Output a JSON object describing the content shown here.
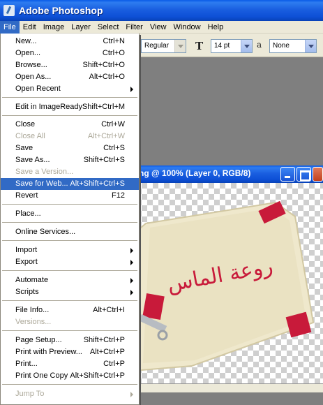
{
  "window": {
    "title": "Adobe Photoshop"
  },
  "menubar": [
    "File",
    "Edit",
    "Image",
    "Layer",
    "Select",
    "Filter",
    "View",
    "Window",
    "Help"
  ],
  "options": {
    "font_style": "Regular",
    "font_size": "14 pt",
    "antialias": "None"
  },
  "document": {
    "title": "ng @ 100% (Layer 0, RGB/8)",
    "artwork_text": "روعة الماس"
  },
  "file_menu": {
    "items": [
      {
        "label": "New...",
        "shortcut": "Ctrl+N"
      },
      {
        "label": "Open...",
        "shortcut": "Ctrl+O"
      },
      {
        "label": "Browse...",
        "shortcut": "Shift+Ctrl+O"
      },
      {
        "label": "Open As...",
        "shortcut": "Alt+Ctrl+O"
      },
      {
        "label": "Open Recent",
        "shortcut": ""
      },
      {
        "label": "Edit in ImageReady",
        "shortcut": "Shift+Ctrl+M"
      },
      {
        "label": "Close",
        "shortcut": "Ctrl+W"
      },
      {
        "label": "Close All",
        "shortcut": "Alt+Ctrl+W"
      },
      {
        "label": "Save",
        "shortcut": "Ctrl+S"
      },
      {
        "label": "Save As...",
        "shortcut": "Shift+Ctrl+S"
      },
      {
        "label": "Save a Version...",
        "shortcut": ""
      },
      {
        "label": "Save for Web...",
        "shortcut": "Alt+Shift+Ctrl+S"
      },
      {
        "label": "Revert",
        "shortcut": "F12"
      },
      {
        "label": "Place...",
        "shortcut": ""
      },
      {
        "label": "Online Services...",
        "shortcut": ""
      },
      {
        "label": "Import",
        "shortcut": ""
      },
      {
        "label": "Export",
        "shortcut": ""
      },
      {
        "label": "Automate",
        "shortcut": ""
      },
      {
        "label": "Scripts",
        "shortcut": ""
      },
      {
        "label": "File Info...",
        "shortcut": "Alt+Ctrl+I"
      },
      {
        "label": "Versions...",
        "shortcut": ""
      },
      {
        "label": "Page Setup...",
        "shortcut": "Shift+Ctrl+P"
      },
      {
        "label": "Print with Preview...",
        "shortcut": "Alt+Ctrl+P"
      },
      {
        "label": "Print...",
        "shortcut": "Ctrl+P"
      },
      {
        "label": "Print One Copy",
        "shortcut": "Alt+Shift+Ctrl+P"
      },
      {
        "label": "Jump To",
        "shortcut": ""
      }
    ]
  },
  "colors": {
    "xp_blue": "#0d4fd6",
    "menu_highlight": "#316ac5",
    "ribbon_red": "#c81a3a"
  }
}
